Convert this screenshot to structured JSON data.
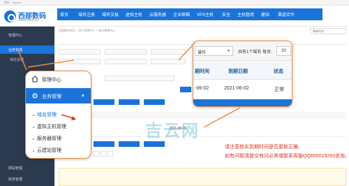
{
  "topbar": {
    "left_text": "首页 · BigKnit",
    "right_text": "···"
  },
  "logo": {
    "name": "西部数码",
    "url": "www.west.cn"
  },
  "nav": {
    "items": [
      "首页",
      "域名注册",
      "域名交易",
      "虚拟主机",
      "云服务器",
      "企业邮箱",
      "VPS主机",
      "安全",
      "主机租用",
      "建站",
      "渠道合作"
    ]
  },
  "sidebar": {
    "header": "管理中心",
    "active": "业务管理",
    "sub": "域名管理",
    "bottom": [
      "网站管理",
      "财务管理"
    ]
  },
  "breadcrumb": "西部数码首页 > 用户管理中心 > 域名管理中心",
  "lang_select": "简体中文",
  "main": {
    "date": "2021-06-02"
  },
  "callout_left": {
    "header": "管理中心",
    "active": "业务管理",
    "items": [
      "域名管理",
      "虚拟主机管理",
      "服务器管理",
      "云建站管理"
    ]
  },
  "callout_right": {
    "select_label": "操作",
    "count_text": "共有1个域名 每页:",
    "page_size": "20",
    "columns": [
      "期时间",
      "到期日期",
      "状态"
    ],
    "row": [
      "-06-02",
      "2021-06-02",
      "正常"
    ]
  },
  "note": {
    "line1": "请注意核实到期时间是否更新正确,",
    "line2": "如有问题请提交有问必答或联系客服QQ800019263咨询。"
  },
  "watermark": "吉云网",
  "colors": {
    "primary": "#1a73d9",
    "accent": "#f08a3c",
    "alert": "#e0331c",
    "sidebar": "#2b3a4f"
  }
}
